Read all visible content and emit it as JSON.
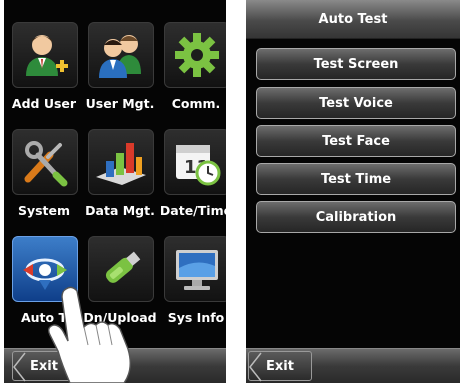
{
  "left_menu": {
    "items": [
      {
        "label": "Add User",
        "icon": "add-user-icon"
      },
      {
        "label": "User Mgt.",
        "icon": "users-icon"
      },
      {
        "label": "Comm.",
        "icon": "gear-icon"
      },
      {
        "label": "System",
        "icon": "tools-icon"
      },
      {
        "label": "Data Mgt.",
        "icon": "bar-chart-icon"
      },
      {
        "label": "Date/Time",
        "icon": "calendar-clock-icon"
      },
      {
        "label": "Auto T",
        "icon": "arrows-circle-icon"
      },
      {
        "label": "Dn/Upload",
        "icon": "usb-drive-icon"
      },
      {
        "label": "Sys Info",
        "icon": "monitor-icon"
      }
    ],
    "exit_label": "Exit"
  },
  "auto_test": {
    "title": "Auto Test",
    "buttons": [
      {
        "label": "Test Screen"
      },
      {
        "label": "Test Voice"
      },
      {
        "label": "Test Face"
      },
      {
        "label": "Test Time"
      },
      {
        "label": "Calibration"
      }
    ],
    "exit_label": "Exit"
  },
  "colors": {
    "background": "#050505",
    "accent_blue": "#2f6fc0",
    "text": "#ffffff"
  }
}
